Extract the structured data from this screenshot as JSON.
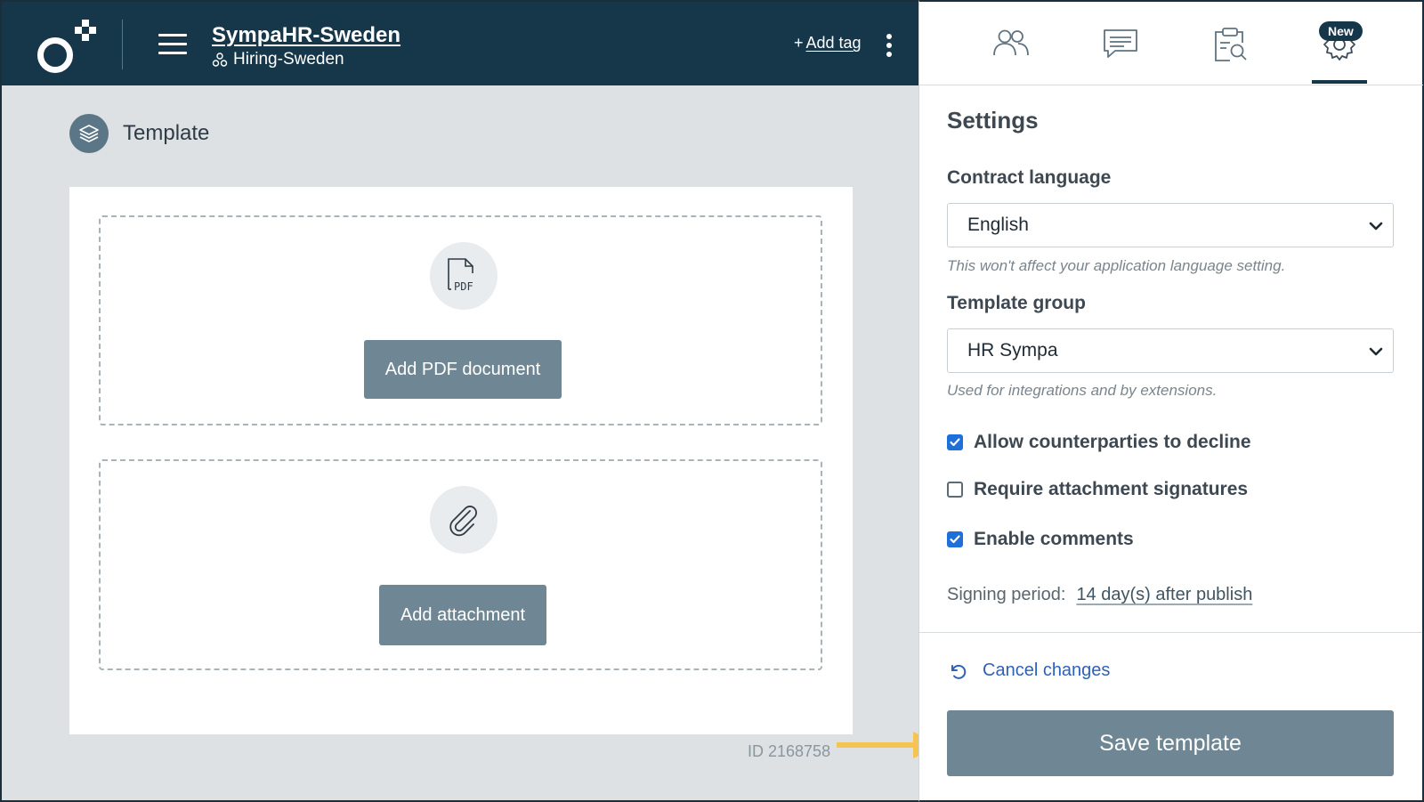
{
  "header": {
    "org_name": "SympaHR-Sweden",
    "group_name": "Hiring-Sweden",
    "add_tag_plus": "+",
    "add_tag_label": "Add tag"
  },
  "template": {
    "heading": "Template",
    "add_pdf_label": "Add PDF document",
    "add_attachment_label": "Add attachment",
    "pdf_icon_text": "PDF",
    "id_label": "ID 2168758"
  },
  "tabs": [
    {
      "icon": "people-icon"
    },
    {
      "icon": "comment-icon"
    },
    {
      "icon": "clipboard-search-icon"
    },
    {
      "icon": "gear-icon",
      "badge": "New",
      "active": true
    }
  ],
  "settings": {
    "title": "Settings",
    "contract_language": {
      "label": "Contract language",
      "value": "English",
      "help": "This won't affect your application language setting."
    },
    "template_group": {
      "label": "Template group",
      "value": "HR Sympa",
      "help": "Used for integrations and by extensions."
    },
    "options": [
      {
        "label": "Allow counterparties to decline",
        "checked": true
      },
      {
        "label": "Require attachment signatures",
        "checked": false
      },
      {
        "label": "Enable comments",
        "checked": true
      }
    ],
    "signing_period_label": "Signing period:",
    "signing_period_value": "14 day(s) after publish",
    "cancel_label": "Cancel changes",
    "save_label": "Save template"
  },
  "colors": {
    "header_bg": "#16364a",
    "primary_button": "#6f8794",
    "checkbox_checked": "#1e6fd9",
    "link": "#2d62b8",
    "arrow": "#f5c451"
  }
}
